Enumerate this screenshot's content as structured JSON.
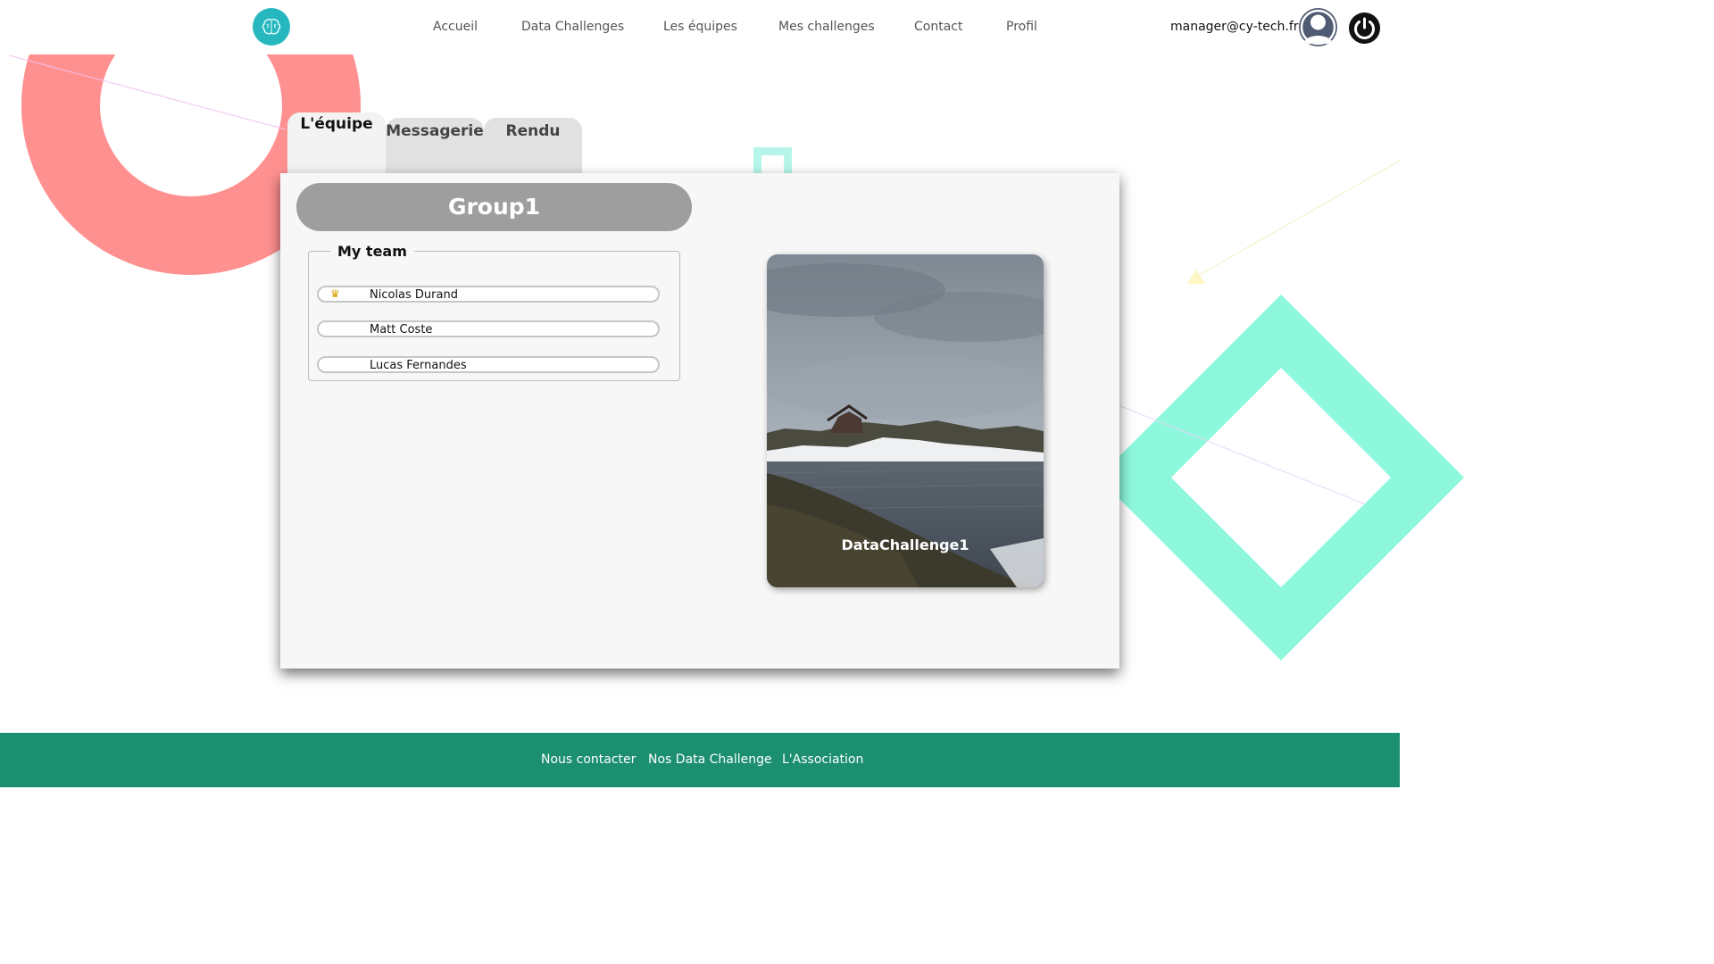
{
  "header": {
    "nav": [
      {
        "label": "Accueil"
      },
      {
        "label": "Data Challenges"
      },
      {
        "label": "Les équipes"
      },
      {
        "label": "Mes challenges"
      },
      {
        "label": "Contact"
      },
      {
        "label": "Profil"
      }
    ],
    "user_email": "manager@cy-tech.fr",
    "icons": {
      "logo": "brain-icon",
      "avatar": "user-avatar-icon",
      "logout": "power-icon"
    }
  },
  "tabs": [
    {
      "label": "L'équipe",
      "active": true
    },
    {
      "label": "Messagerie",
      "active": false
    },
    {
      "label": "Rendu",
      "active": false
    }
  ],
  "team": {
    "group_name": "Group1",
    "legend": "My team",
    "members": [
      {
        "name": "Nicolas Durand",
        "leader": true
      },
      {
        "name": "Matt Coste",
        "leader": false
      },
      {
        "name": "Lucas Fernandes",
        "leader": false
      }
    ]
  },
  "challenge": {
    "title": "DataChallenge1",
    "image": "mountain-lake-landscape"
  },
  "footer": {
    "links": [
      {
        "label": "Nous contacter"
      },
      {
        "label": "Nos Data Challenge"
      },
      {
        "label": "L'Association"
      }
    ]
  },
  "colors": {
    "accent_teal": "#26b8be",
    "footer_green": "#1b8f6f",
    "deco_coral": "#ff9090",
    "deco_mint": "#8ef8dd"
  }
}
